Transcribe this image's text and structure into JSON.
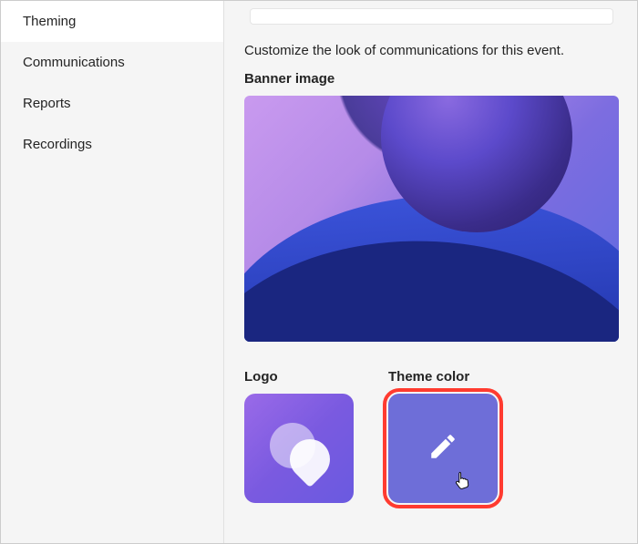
{
  "sidebar": {
    "items": [
      {
        "label": "Theming",
        "active": true
      },
      {
        "label": "Communications",
        "active": false
      },
      {
        "label": "Reports",
        "active": false
      },
      {
        "label": "Recordings",
        "active": false
      }
    ]
  },
  "main": {
    "description": "Customize the look of communications for this event.",
    "banner_title": "Banner image",
    "logo_title": "Logo",
    "theme_color_title": "Theme color"
  },
  "colors": {
    "theme_tile": "#6e6ed8",
    "highlight": "#ff3b30"
  }
}
